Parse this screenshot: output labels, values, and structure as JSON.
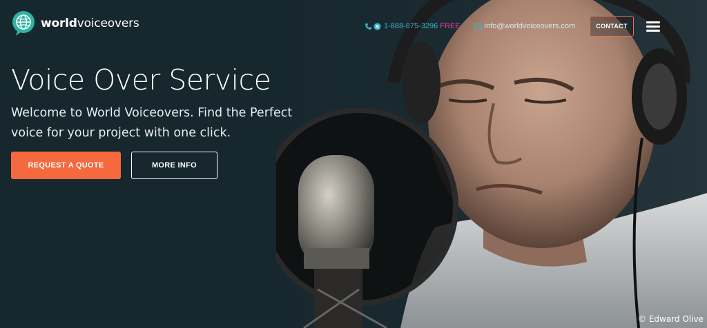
{
  "header": {
    "logo_bold": "world",
    "logo_rest": "voiceovers",
    "phone": "1-888-875-3296",
    "phone_suffix": "FREE",
    "email": "info@worldvoiceovers.com",
    "contact_label": "CONTACT"
  },
  "hero": {
    "title": "Voice Over Service",
    "subtitle": "Welcome to World Voiceovers. Find the Perfect voice for your project with one click.",
    "primary_button": "REQUEST A QUOTE",
    "secondary_button": "MORE INFO",
    "photo_credit": "© Edward Olive"
  },
  "colors": {
    "background": "#17272e",
    "accent_orange": "#f4693e",
    "phone_teal": "#3bb4c9",
    "free_pink": "#e93d8f"
  },
  "icons": [
    "globe-chat-logo-icon",
    "phone-icon",
    "skype-icon",
    "mail-icon",
    "hamburger-menu-icon"
  ]
}
